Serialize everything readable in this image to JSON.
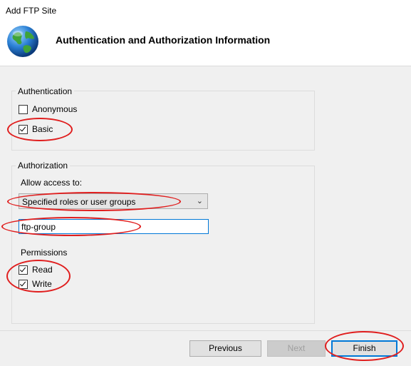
{
  "window": {
    "title": "Add FTP Site"
  },
  "header": {
    "heading": "Authentication and Authorization Information",
    "icon": "globe-icon"
  },
  "authentication": {
    "legend": "Authentication",
    "options": [
      {
        "label": "Anonymous",
        "checked": false
      },
      {
        "label": "Basic",
        "checked": true
      }
    ]
  },
  "authorization": {
    "legend": "Authorization",
    "allow_access_label": "Allow access to:",
    "allow_access_value": "Specified roles or user groups",
    "groups_value": "ftp-group",
    "permissions_label": "Permissions",
    "permissions": [
      {
        "label": "Read",
        "checked": true
      },
      {
        "label": "Write",
        "checked": true
      }
    ]
  },
  "buttons": {
    "previous": "Previous",
    "next": "Next",
    "finish": "Finish"
  },
  "annotation_color": "#e01e1e"
}
